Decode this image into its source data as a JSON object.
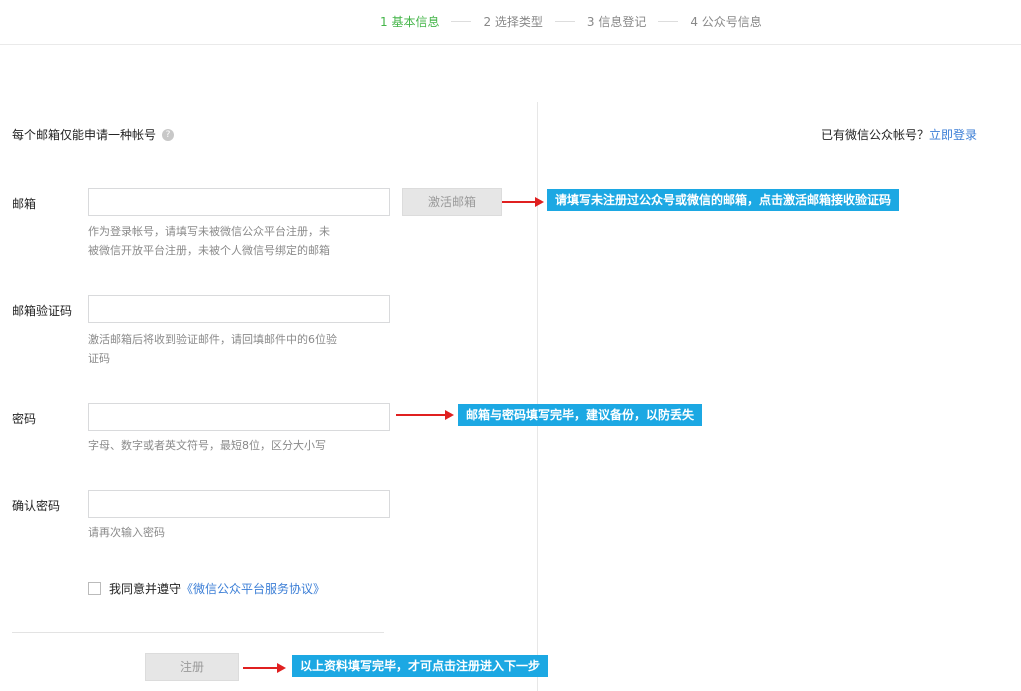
{
  "steps": [
    {
      "label": "1 基本信息"
    },
    {
      "label": "2 选择类型"
    },
    {
      "label": "3 信息登记"
    },
    {
      "label": "4 公众号信息"
    }
  ],
  "notice": "每个邮箱仅能申请一种帐号",
  "help_icon_glyph": "?",
  "login_prompt": "已有微信公众帐号？",
  "login_link": "立即登录",
  "form": {
    "email_label": "邮箱",
    "email_value": "",
    "activate_button": "激活邮箱",
    "email_hint_line1": "作为登录帐号，请填写未被微信公众平台注册，未",
    "email_hint_line2": "被微信开放平台注册，未被个人微信号绑定的邮箱",
    "code_label": "邮箱验证码",
    "code_value": "",
    "code_hint_line1": "激活邮箱后将收到验证邮件，请回填邮件中的6位验",
    "code_hint_line2": "证码",
    "password_label": "密码",
    "password_value": "",
    "password_hint": "字母、数字或者英文符号，最短8位，区分大小写",
    "confirm_label": "确认密码",
    "confirm_value": "",
    "confirm_hint": "请再次输入密码",
    "agree_text": "我同意并遵守",
    "agreement_link": "《微信公众平台服务协议》",
    "agree_checked": false,
    "register_button": "注册"
  },
  "annotations": {
    "email": "请填写未注册过公众号或微信的邮箱，点击激活邮箱接收验证码",
    "password": "邮箱与密码填写完毕，建议备份，以防丢失",
    "register": "以上资料填写完毕，才可点击注册进入下一步"
  },
  "colors": {
    "active_step": "#44b549",
    "link": "#3b7ed6",
    "callout_bg": "#1ca8e3",
    "arrow": "#e02020"
  }
}
